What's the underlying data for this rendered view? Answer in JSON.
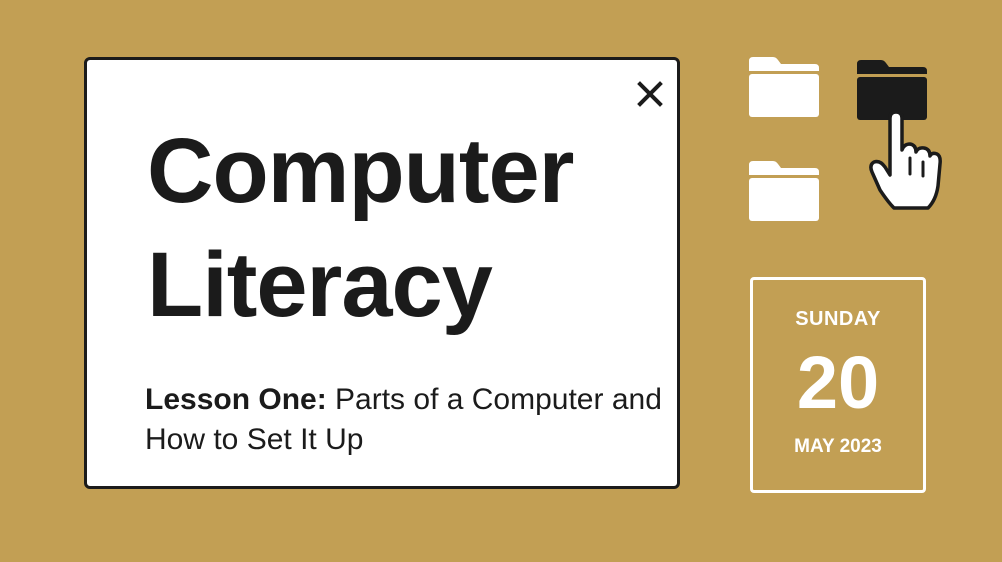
{
  "dialog": {
    "title_line1": "Computer",
    "title_line2": "Literacy",
    "subtitle_bold": "Lesson One:",
    "subtitle_rest": " Parts of a Computer and How to Set It Up",
    "close_icon": "close-icon"
  },
  "desktop_icons": [
    {
      "icon": "folder-icon",
      "state": "normal"
    },
    {
      "icon": "folder-icon",
      "state": "selected"
    },
    {
      "icon": "folder-icon",
      "state": "normal"
    }
  ],
  "cursor": {
    "icon": "hand-pointer-icon"
  },
  "calendar": {
    "day": "SUNDAY",
    "date": "20",
    "month_year": "MAY 2023"
  },
  "colors": {
    "background": "#c29f54",
    "dialog_bg": "#ffffff",
    "text": "#1b1b1b",
    "folder_light": "#ffffff",
    "folder_dark": "#1b1b1b"
  }
}
